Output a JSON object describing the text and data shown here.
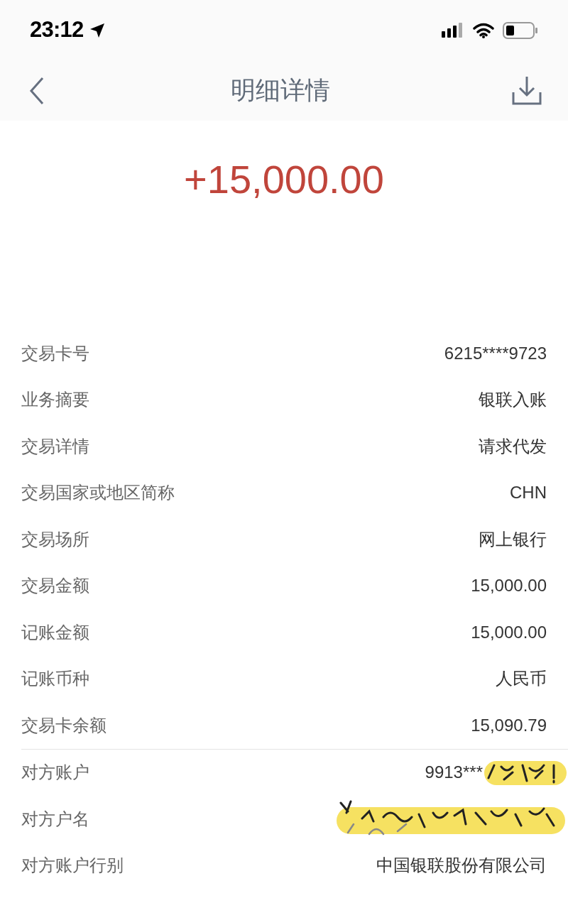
{
  "status_bar": {
    "time": "23:12"
  },
  "nav": {
    "title": "明细详情"
  },
  "amount": "+15,000.00",
  "sections": [
    {
      "rows": [
        {
          "label": "交易卡号",
          "value": "6215****9723",
          "redacted": false
        },
        {
          "label": "业务摘要",
          "value": "银联入账",
          "redacted": false
        },
        {
          "label": "交易详情",
          "value": "请求代发",
          "redacted": false
        },
        {
          "label": "交易国家或地区简称",
          "value": "CHN",
          "redacted": false
        },
        {
          "label": "交易场所",
          "value": "网上银行",
          "redacted": false
        },
        {
          "label": "交易金额",
          "value": "15,000.00",
          "redacted": false
        },
        {
          "label": "记账金额",
          "value": "15,000.00",
          "redacted": false
        },
        {
          "label": "记账币种",
          "value": "人民币",
          "redacted": false
        },
        {
          "label": "交易卡余额",
          "value": "15,090.79",
          "redacted": false
        }
      ]
    },
    {
      "rows": [
        {
          "label": "对方账户",
          "value": "9913***",
          "redacted": true
        },
        {
          "label": "对方户名",
          "redacted": true
        },
        {
          "label": "对方账户行别",
          "value": "中国银联股份有限公司",
          "redacted": false
        }
      ]
    }
  ]
}
